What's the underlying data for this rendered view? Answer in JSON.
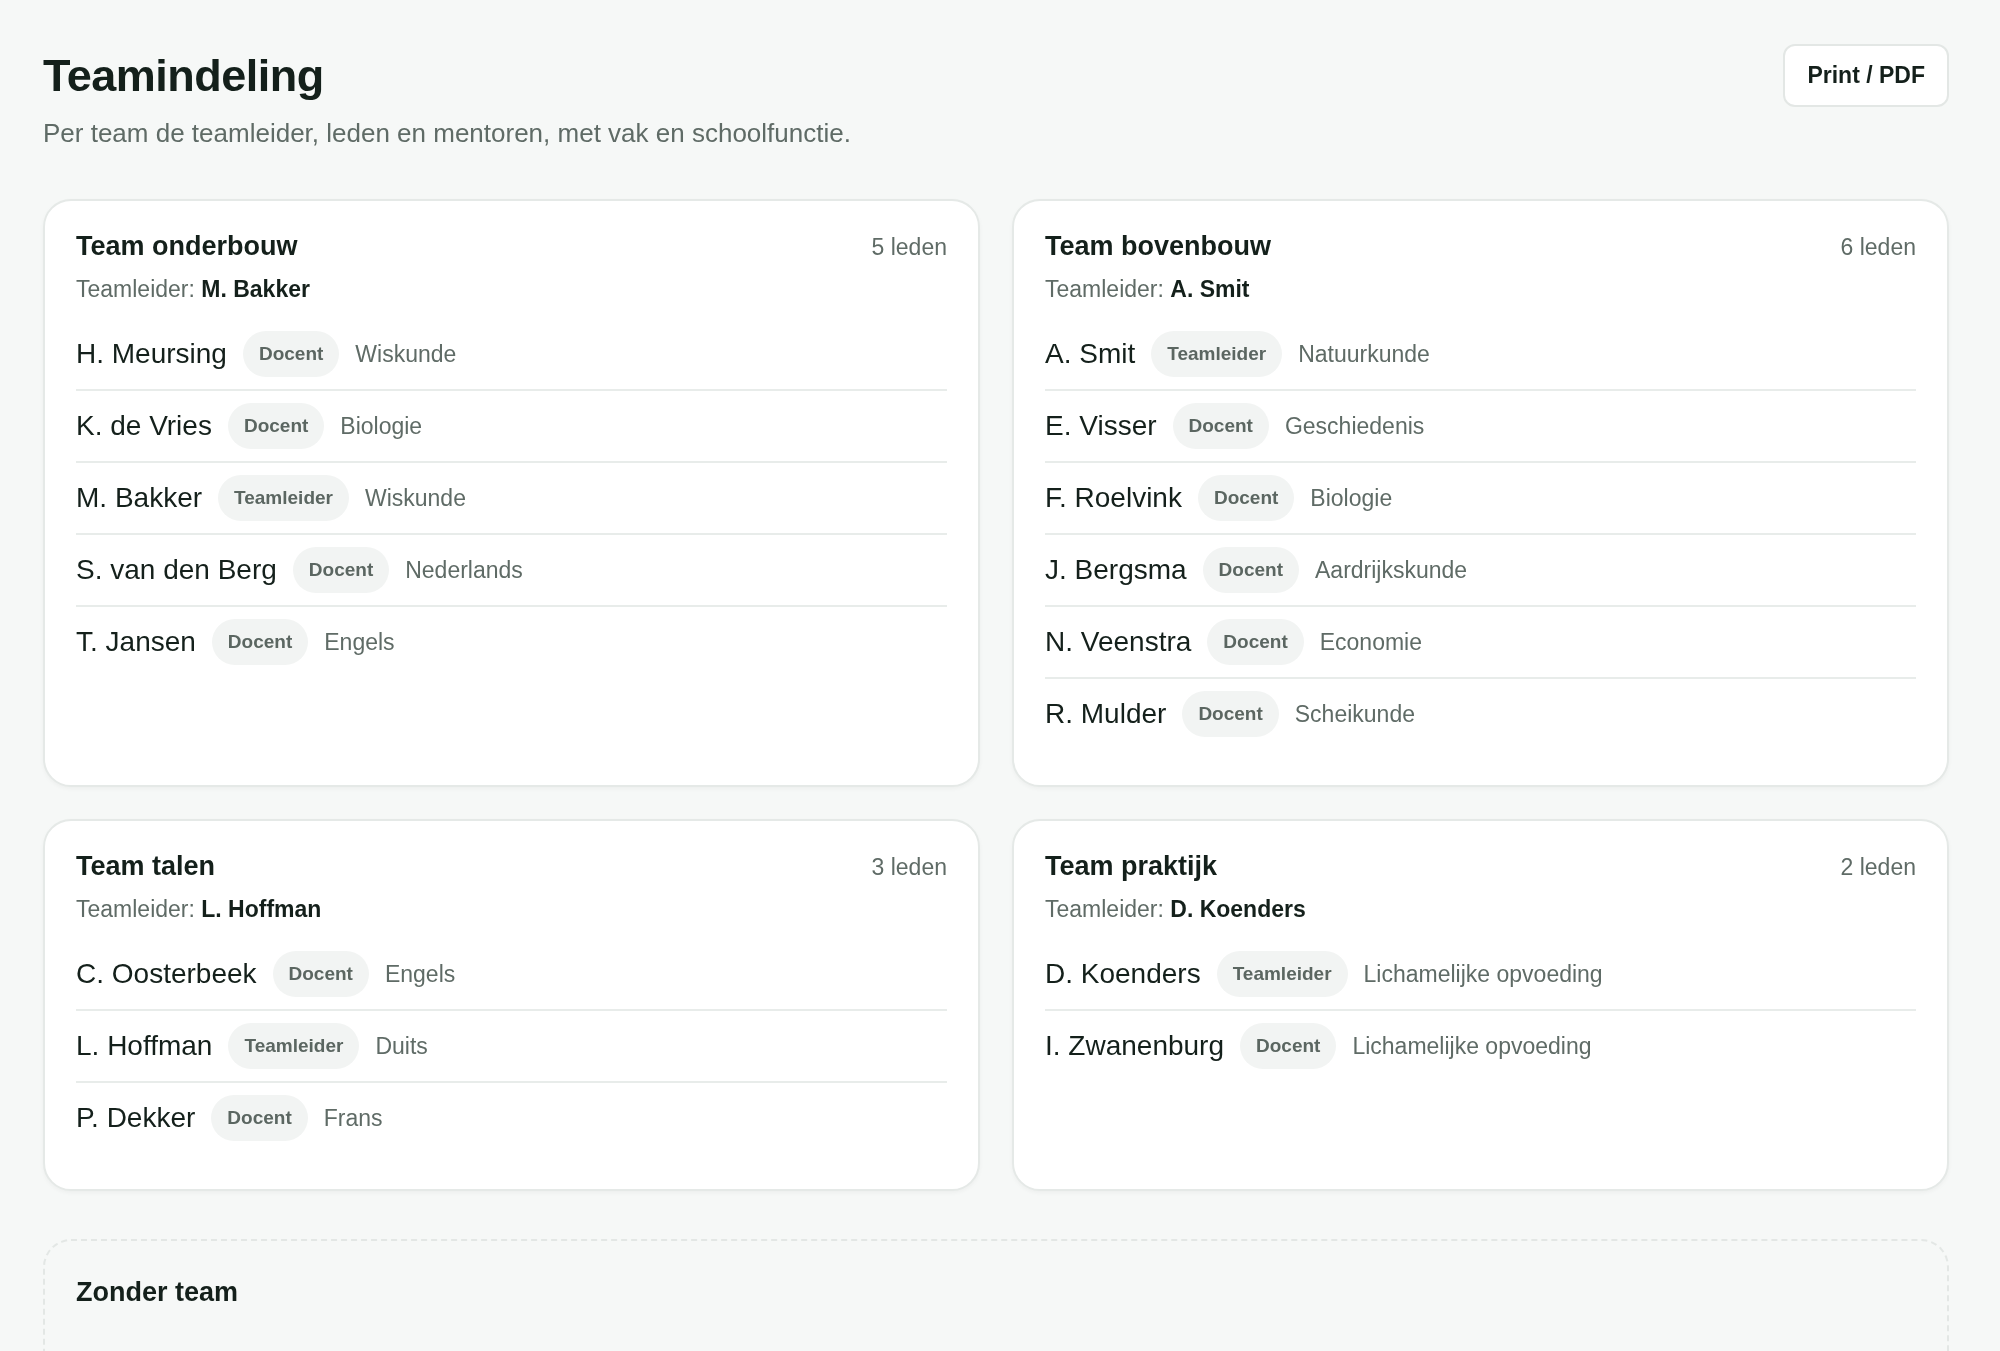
{
  "header": {
    "title": "Teamindeling",
    "subtitle": "Per team de teamleider, leden en mentoren, met vak en schoolfunctie.",
    "print_button": "Print / PDF"
  },
  "teams": [
    {
      "name": "Team onderbouw",
      "count": "5 leden",
      "leader": "Teamleider: **M. Bakker**",
      "members": [
        {
          "name": "H. Meursing",
          "role": "Docent",
          "subject": "Wiskunde"
        },
        {
          "name": "K. de Vries",
          "role": "Docent",
          "subject": "Biologie"
        },
        {
          "name": "M. Bakker",
          "role": "Teamleider",
          "subject": "Wiskunde"
        },
        {
          "name": "S. van den Berg",
          "role": "Docent",
          "subject": "Nederlands"
        },
        {
          "name": "T. Jansen",
          "role": "Docent",
          "subject": "Engels"
        }
      ]
    },
    {
      "name": "Team bovenbouw",
      "count": "6 leden",
      "leader": "Teamleider: **A. Smit**",
      "members": [
        {
          "name": "A. Smit",
          "role": "Teamleider",
          "subject": "Natuurkunde"
        },
        {
          "name": "E. Visser",
          "role": "Docent",
          "subject": "Geschiedenis"
        },
        {
          "name": "F. Roelvink",
          "role": "Docent",
          "subject": "Biologie"
        },
        {
          "name": "J. Bergsma",
          "role": "Docent",
          "subject": "Aardrijkskunde"
        },
        {
          "name": "N. Veenstra",
          "role": "Docent",
          "subject": "Economie"
        },
        {
          "name": "R. Mulder",
          "role": "Docent",
          "subject": "Scheikunde"
        }
      ]
    },
    {
      "name": "Team talen",
      "count": "3 leden",
      "leader": "Teamleider: **L. Hoffman**",
      "members": [
        {
          "name": "C. Oosterbeek",
          "role": "Docent",
          "subject": "Engels"
        },
        {
          "name": "L. Hoffman",
          "role": "Teamleider",
          "subject": "Duits"
        },
        {
          "name": "P. Dekker",
          "role": "Docent",
          "subject": "Frans"
        }
      ]
    },
    {
      "name": "Team praktijk",
      "count": "2 leden",
      "leader": "Teamleider: **D. Koenders**",
      "members": [
        {
          "name": "D. Koenders",
          "role": "Teamleider",
          "subject": "Lichamelijke opvoeding"
        },
        {
          "name": "I. Zwanenburg",
          "role": "Docent",
          "subject": "Lichamelijke opvoeding"
        }
      ]
    }
  ],
  "unassigned": {
    "title": "Zonder team"
  }
}
